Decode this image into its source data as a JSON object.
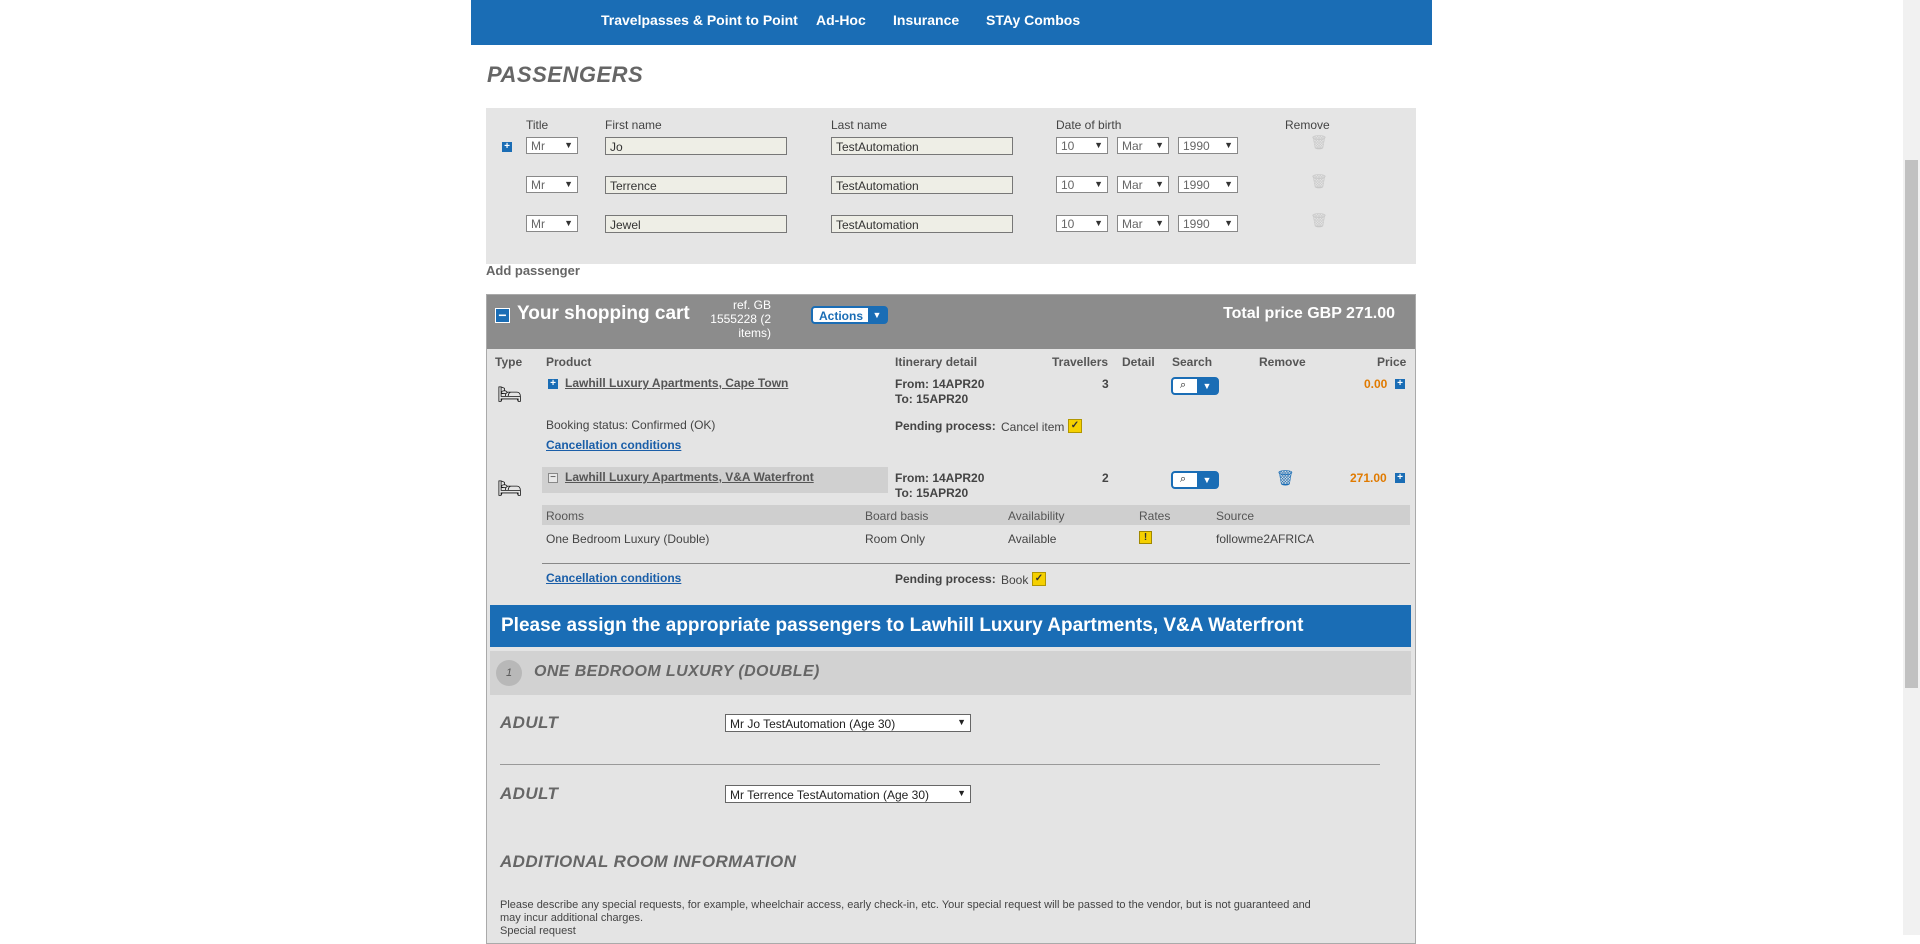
{
  "nav": {
    "items": [
      "Travelpasses & Point to Point",
      "Ad-Hoc",
      "Insurance",
      "STAy Combos"
    ]
  },
  "passengers": {
    "title": "PASSENGERS",
    "columns": {
      "title": "Title",
      "first_name": "First name",
      "last_name": "Last name",
      "dob": "Date of birth",
      "remove": "Remove"
    },
    "rows": [
      {
        "title": "Mr",
        "first": "Jo",
        "last": "TestAutomation",
        "day": "10",
        "month": "Mar",
        "year": "1990"
      },
      {
        "title": "Mr",
        "first": "Terrence",
        "last": "TestAutomation",
        "day": "10",
        "month": "Mar",
        "year": "1990"
      },
      {
        "title": "Mr",
        "first": "Jewel",
        "last": "TestAutomation",
        "day": "10",
        "month": "Mar",
        "year": "1990"
      }
    ],
    "add_label": "Add passenger"
  },
  "cart": {
    "title": "Your shopping cart",
    "ref": "ref. GB 1555228 (2 items)",
    "ref_lines": [
      "ref. GB",
      "1555228 (2",
      "items)"
    ],
    "actions_label": "Actions",
    "total": "Total price GBP 271.00",
    "columns": {
      "type": "Type",
      "product": "Product",
      "itinerary": "Itinerary detail",
      "travellers": "Travellers",
      "detail": "Detail",
      "search": "Search",
      "remove": "Remove",
      "price": "Price"
    },
    "items": [
      {
        "product": "Lawhill Luxury Apartments, Cape Town",
        "from": "From: 14APR20",
        "to": "To: 15APR20",
        "travellers": "3",
        "price": "0.00",
        "booking_status": "Booking status: Confirmed (OK)",
        "cancellation": "Cancellation conditions",
        "pending_label": "Pending process:",
        "pending_value": "Cancel item"
      },
      {
        "product": "Lawhill Luxury Apartments, V&A Waterfront",
        "from": "From: 14APR20",
        "to": "To: 15APR20",
        "travellers": "2",
        "price": "271.00",
        "room_columns": {
          "rooms": "Rooms",
          "board": "Board basis",
          "availability": "Availability",
          "rates": "Rates",
          "source": "Source"
        },
        "room": {
          "name": "One Bedroom Luxury (Double)",
          "board": "Room Only",
          "availability": "Available",
          "source": "followme2AFRICA"
        },
        "cancellation": "Cancellation conditions",
        "pending_label": "Pending process:",
        "pending_value": "Book"
      }
    ]
  },
  "assign": {
    "heading": "Please assign the appropriate passengers to Lawhill Luxury Apartments, V&A Waterfront",
    "room_number": "1",
    "room_title": "ONE BEDROOM LUXURY (DOUBLE)",
    "slots": [
      {
        "label": "ADULT",
        "value": "Mr Jo TestAutomation (Age 30)"
      },
      {
        "label": "ADULT",
        "value": "Mr Terrence TestAutomation (Age 30)"
      }
    ],
    "additional_title": "ADDITIONAL ROOM INFORMATION",
    "additional_text_1": "Please describe any special requests, for example, wheelchair access, early check-in, etc. Your special request will be passed to the vendor, but is not guaranteed and",
    "additional_text_2": "may incur additional charges.",
    "special_request_label": "Special request"
  },
  "icons": {
    "trash": "trash-icon",
    "bed": "bed-icon",
    "search": "search-icon",
    "expand": "plus-icon",
    "collapse": "minus-icon",
    "warning": "warning-icon",
    "pending": "pending-icon"
  },
  "colors": {
    "brand_blue": "#1a6db5",
    "cart_header": "#8c8c8c",
    "price_orange": "#e07a00",
    "pending_yellow": "#f5d000"
  }
}
